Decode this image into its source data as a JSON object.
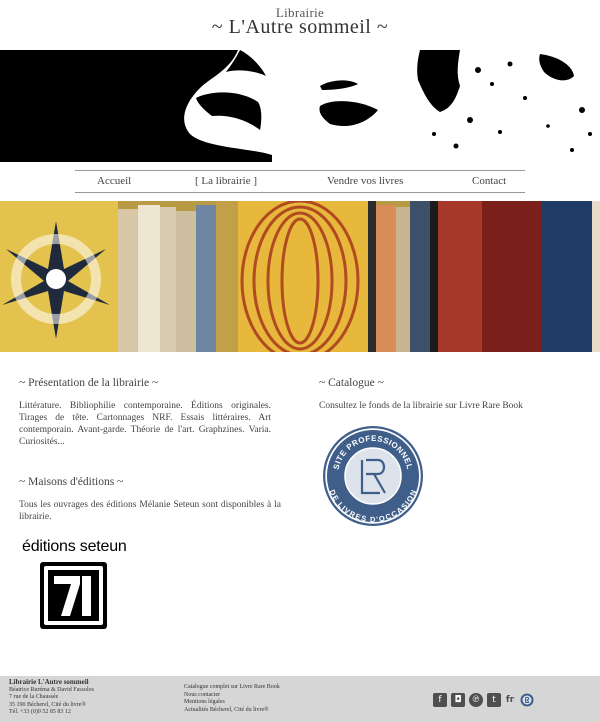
{
  "header": {
    "subtitle": "Librairie",
    "title": "~ L'Autre sommeil ~"
  },
  "nav": {
    "items": [
      "Accueil",
      "[ La librairie ]",
      "Vendre vos livres",
      "Contact"
    ]
  },
  "presentation": {
    "heading": "~ Présentation de la librairie ~",
    "text": "Littérature. Bibliophilie contemporaine. Éditions originales. Tirages de tête. Cartonnages NRF. Essais littéraires. Art contemporain. Avant-garde. Théorie de l'art. Graphzines. Varia. Curiosités..."
  },
  "catalogue": {
    "heading": "~ Catalogue ~",
    "text": "Consultez le fonds de la librairie sur Livre Rare Book",
    "badge_top": "SITE PROFESSIONNEL",
    "badge_bottom": "DE LIVRES D'OCCASION"
  },
  "maisons": {
    "heading": "~ Maisons d'éditions ~",
    "text": "Tous les ouvrages des éditions Mélanie Seteun sont disponibles à la librairie.",
    "logo_text": "éditions seteun",
    "logo_mark": "7l"
  },
  "footer": {
    "col1": [
      "Librairie L'Autre sommeil",
      "Béatrice Ruréma & David Fassolos",
      "7 rue de la Chaussée",
      "35 190 Bécherel, Cité du livre®",
      "Tél. +33 (0)9 52 85 83 12"
    ],
    "col2": [
      "Catalogue complet sur Livre Rare Book",
      "Nous contacter",
      "Mentions légales",
      "Actualités Bécherel, Cité du livre®"
    ],
    "social": [
      {
        "icon": "facebook-icon",
        "glyph": "f"
      },
      {
        "icon": "instagram-icon",
        "glyph": "◘"
      },
      {
        "icon": "pinterest-icon",
        "glyph": "℗"
      },
      {
        "icon": "tumblr-icon",
        "glyph": "t"
      }
    ],
    "lang": "fr"
  },
  "colors": {
    "footer_bg": "#d6d6d6",
    "badge_blue": "#3f5f8a"
  }
}
